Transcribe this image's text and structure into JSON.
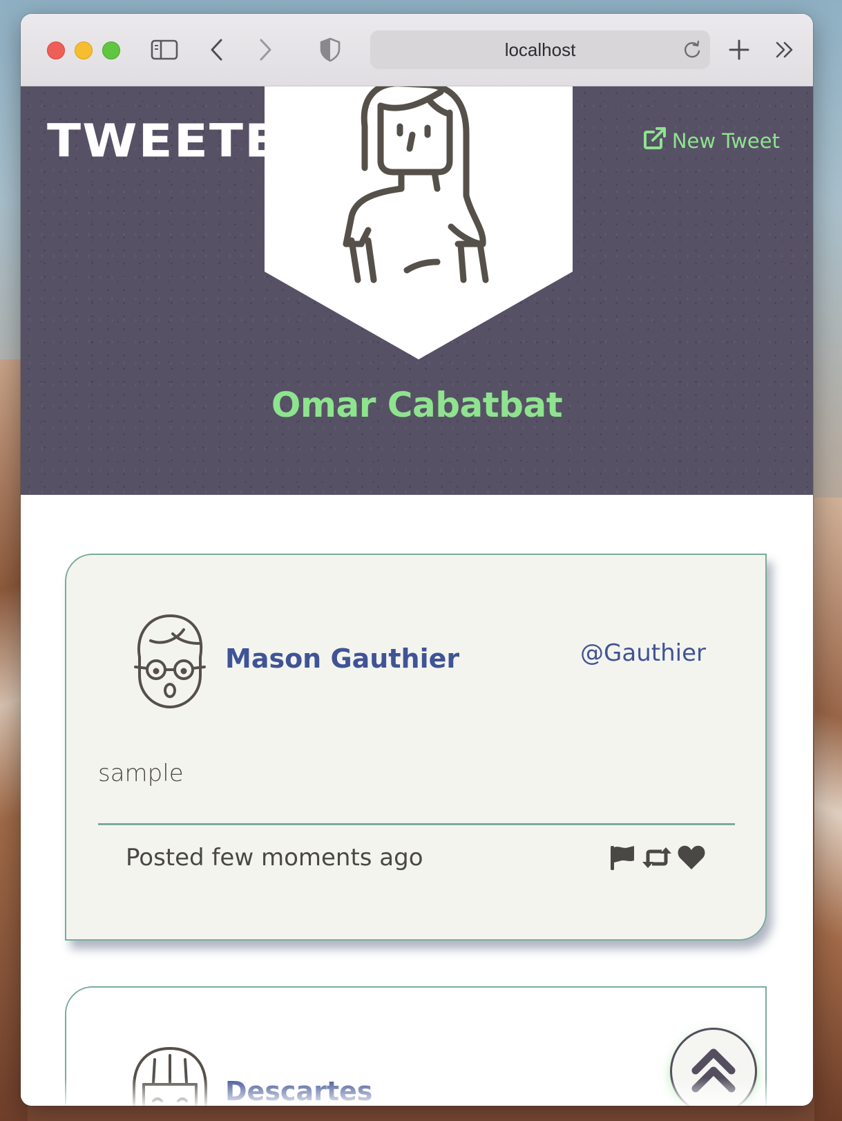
{
  "browser": {
    "url": "localhost",
    "icons": {
      "sidebar": "sidebar-toggle-icon",
      "back": "chevron-left-icon",
      "forward": "chevron-right-icon",
      "privacy": "shield-icon",
      "reload": "reload-icon",
      "new_tab": "plus-icon",
      "more": "double-chevron-right-icon"
    }
  },
  "header": {
    "brand": "TWEETE",
    "new_tweet_label": "New Tweet",
    "new_tweet_icon": "external-link-icon"
  },
  "profile": {
    "name": "Omar Cabatbat",
    "avatar": "woman-avatar-icon"
  },
  "tweets": [
    {
      "name": "Mason Gauthier",
      "handle": "@Gauthier",
      "text": "sample",
      "time": "Posted few moments ago",
      "avatar": "man-glasses-avatar-icon",
      "actions": [
        "flag-icon",
        "retweet-icon",
        "heart-icon"
      ]
    },
    {
      "name": "Descartes",
      "avatar": "woman-bangs-avatar-icon"
    }
  ],
  "scroll_top_icon": "double-chevron-up-icon",
  "colors": {
    "hero_bg": "#575166",
    "accent_green": "#8ee48e",
    "name_blue": "#3f5496",
    "card_border": "#7aab9c",
    "card_bg": "#f4f4ef",
    "icon_dark": "#4a4844"
  }
}
